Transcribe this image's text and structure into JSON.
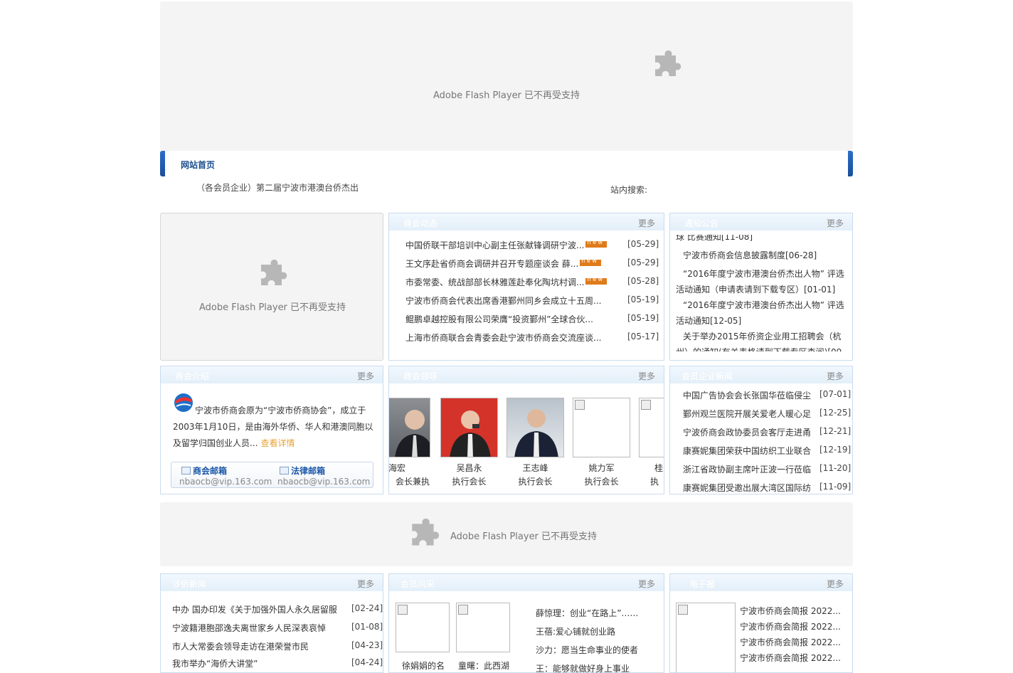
{
  "flash": {
    "message": "Adobe Flash Player 已不再受支持"
  },
  "nav": {
    "home": "网站首页"
  },
  "ticker": "（各会员企业）第二届宁波市港澳台侨杰出",
  "search_label": "站内搜索:",
  "more": "更多",
  "panels": {
    "chamber_news": {
      "title": "商会动态",
      "items": [
        {
          "title": "中国侨联干部培训中心副主任张献锋调研宁波...",
          "date": "[05-29]",
          "is_new": true
        },
        {
          "title": "王文序赴省侨商会调研并召开专题座谈会 薛...",
          "date": "[05-29]",
          "is_new": true
        },
        {
          "title": "市委常委、统战部部长林雅莲赴奉化陶坑村调...",
          "date": "[05-28]",
          "is_new": true
        },
        {
          "title": "宁波市侨商会代表出席香港鄞州同乡会成立十五周...",
          "date": "[05-19]",
          "is_new": false
        },
        {
          "title": "鲲鹏卓越控股有限公司荣膺“投资鄞州”全球合伙...",
          "date": "[05-19]",
          "is_new": false
        },
        {
          "title": "上海市侨商联合会青委会赴宁波市侨商会交流座谈...",
          "date": "[05-17]",
          "is_new": false
        }
      ]
    },
    "notices": {
      "title": "通知公告",
      "lines": [
        "球 比赛通知[11-08]",
        "宁波市侨商会信息披露制度[06-28]",
        "“2016年度宁波市港澳台侨杰出人物” 评选",
        "活动通知（申请表请到下载专区）[01-01]",
        "“2016年度宁波市港澳台侨杰出人物” 评选",
        "活动通知[12-05]",
        "关于举办2015年侨资企业用工招聘会（杭",
        "州）的通知(有关表格请到下载专区查阅)[09"
      ]
    },
    "intro": {
      "title": "商会介绍",
      "text1": "宁波市侨商会原为“宁波市侨商协会”，成立于",
      "text2": "2003年1月10日，是由海外华侨、华人和港澳同胞以",
      "text3": "及留学归国创业人员...",
      "detail_link": "查看详情",
      "mail_label": "商会邮箱",
      "mail_addr": "nbaocb@vip.163.com",
      "legal_label": "法律邮箱",
      "legal_addr": "nbaocb@vip.163.com"
    },
    "leaders": {
      "title": "商会领导",
      "people": [
        {
          "name": "海宏",
          "position": "会长兼执"
        },
        {
          "name": "吴昌永",
          "position": "执行会长"
        },
        {
          "name": "王志峰",
          "position": "执行会长"
        },
        {
          "name": "姚力军",
          "position": "执行会长"
        },
        {
          "name": "桂",
          "position": "执"
        }
      ]
    },
    "member_news": {
      "title": "会员企业新闻",
      "items": [
        {
          "title": "中国广告协会会长张国华莅临侵尘",
          "date": "[07-01]"
        },
        {
          "title": "鄞州观兰医院开展关爱老人暖心足",
          "date": "[12-25]"
        },
        {
          "title": "宁波侨商会政协委员会客厅走进甬",
          "date": "[12-21]"
        },
        {
          "title": "康赛妮集团荣获中国纺织工业联合",
          "date": "[12-19]"
        },
        {
          "title": "浙江省政协副主席叶正波一行莅临",
          "date": "[11-20]"
        },
        {
          "title": "康赛妮集团受邀出展大湾区国际纺",
          "date": "[11-09]"
        }
      ]
    },
    "overseas_news": {
      "title": "涉侨新闻",
      "items": [
        {
          "title": "中办 国办印发《关于加强外国人永久居留服",
          "date": "[02-24]"
        },
        {
          "title": "宁波籍港胞邵逸夫离世家乡人民深表哀悼",
          "date": "[01-08]"
        },
        {
          "title": "市人大常委会领导走访在港荣誉市民",
          "date": "[04-23]"
        },
        {
          "title": "我市举办“海侨大讲堂”",
          "date": "[04-24]"
        }
      ]
    },
    "member_style": {
      "title": "会员风采",
      "captions": [
        "徐娟娟的名",
        "童曙：此西湖"
      ],
      "links": [
        "薛惊理：创业“在路上”……",
        "王蓓:爱心铺就创业路",
        "沙力：愿当生命事业的使者",
        "王：能够就做好身上事业"
      ]
    },
    "enewspaper": {
      "title": "电子报",
      "items": [
        "宁波市侨商会简报 2022...",
        "宁波市侨商会简报 2022...",
        "宁波市侨商会简报 2022...",
        "宁波市侨商会简报 2022..."
      ]
    }
  },
  "colors": {
    "accent": "#1d4f8f",
    "panel_border": "#c9dcef",
    "new_badge": "#e07b1a",
    "detail_link": "#e8a33a"
  }
}
